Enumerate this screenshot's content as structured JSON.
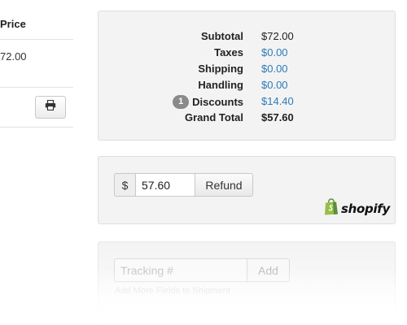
{
  "left_table": {
    "price_header": "Price",
    "price_value": "72.00"
  },
  "totals": {
    "rows": [
      {
        "label": "Subtotal",
        "value": "$72.00"
      },
      {
        "label": "Taxes",
        "value": "$0.00"
      },
      {
        "label": "Shipping",
        "value": "$0.00"
      },
      {
        "label": "Handling",
        "value": "$0.00"
      },
      {
        "label": "Discounts",
        "value": "$14.40",
        "badge": "1"
      },
      {
        "label": "Grand Total",
        "value": "$57.60"
      }
    ]
  },
  "refund": {
    "currency_symbol": "$",
    "amount": "57.60",
    "button_label": "Refund",
    "brand": "shopify"
  },
  "tracking": {
    "placeholder": "Tracking #",
    "add_label": "Add",
    "add_more_link": "Add More Fields to Shipment"
  },
  "colors": {
    "link": "#2b7bb9",
    "card_bg": "#f3f3f3",
    "shopify_green": "#95bf47"
  },
  "icons": {
    "print": "printer-icon",
    "brand": "shopify-bag-icon"
  }
}
